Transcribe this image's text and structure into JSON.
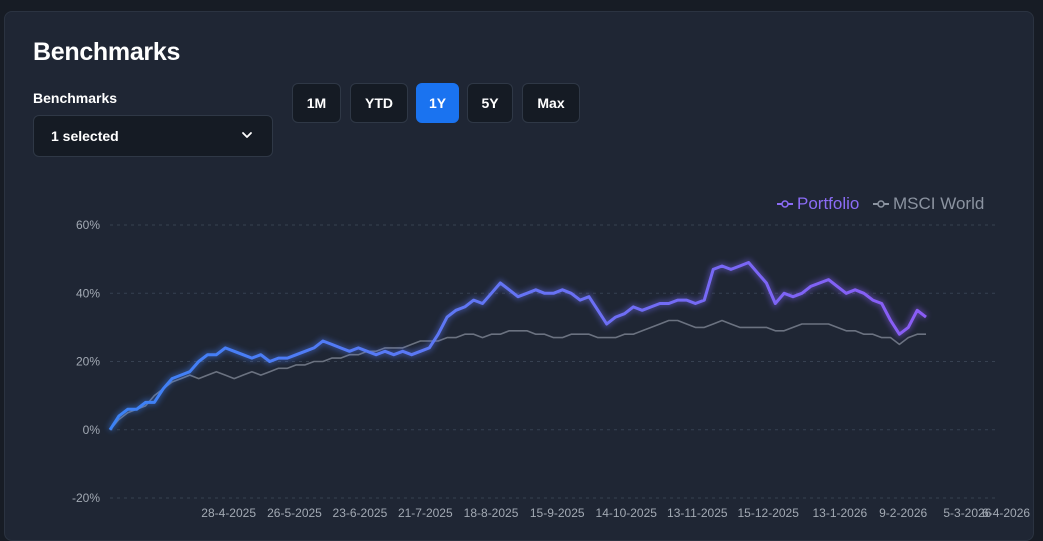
{
  "card": {
    "title": "Benchmarks"
  },
  "benchmarks_select": {
    "label": "Benchmarks",
    "value": "1 selected"
  },
  "range_buttons": [
    {
      "label": "1M",
      "active": false
    },
    {
      "label": "YTD",
      "active": false
    },
    {
      "label": "1Y",
      "active": true
    },
    {
      "label": "5Y",
      "active": false
    },
    {
      "label": "Max",
      "active": false
    }
  ],
  "colors": {
    "portfolio": "#8b6cf6",
    "portfolio_start": "#3b82f6",
    "msci": "#6b7280",
    "accent": "#1a73f0"
  },
  "chart_data": {
    "type": "line",
    "legend_position": "top-right",
    "ylim": [
      -20,
      60
    ],
    "y_ticks": [
      "60%",
      "40%",
      "20%",
      "0%",
      "-20%"
    ],
    "y_tick_values": [
      60,
      40,
      20,
      0,
      -20
    ],
    "grid": true,
    "x_tick_labels": [
      "28-4-2025",
      "26-5-2025",
      "23-6-2025",
      "21-7-2025",
      "18-8-2025",
      "15-9-2025",
      "14-10-2025",
      "13-11-2025",
      "15-12-2025",
      "13-1-2026",
      "9-2-2026",
      "5-3-2026",
      "6-4-2026"
    ],
    "x_tick_positions": [
      0.0789,
      0.1568,
      0.2342,
      0.3116,
      0.3894,
      0.4677,
      0.5494,
      0.6335,
      0.7174,
      0.8022,
      0.8771,
      0.9531,
      0.9989
    ],
    "series": [
      {
        "name": "Portfolio",
        "points": [
          [
            0,
            0
          ],
          [
            0.01,
            4
          ],
          [
            0.02,
            6
          ],
          [
            0.03,
            6
          ],
          [
            0.04,
            8
          ],
          [
            0.05,
            8
          ],
          [
            0.06,
            12
          ],
          [
            0.07,
            15
          ],
          [
            0.08,
            16
          ],
          [
            0.09,
            17
          ],
          [
            0.1,
            20
          ],
          [
            0.11,
            22
          ],
          [
            0.12,
            22
          ],
          [
            0.13,
            24
          ],
          [
            0.14,
            23
          ],
          [
            0.15,
            22
          ],
          [
            0.16,
            21
          ],
          [
            0.17,
            22
          ],
          [
            0.18,
            20
          ],
          [
            0.19,
            21
          ],
          [
            0.2,
            21
          ],
          [
            0.21,
            22
          ],
          [
            0.22,
            23
          ],
          [
            0.23,
            24
          ],
          [
            0.24,
            26
          ],
          [
            0.25,
            25
          ],
          [
            0.26,
            24
          ],
          [
            0.27,
            23
          ],
          [
            0.28,
            24
          ],
          [
            0.29,
            23
          ],
          [
            0.3,
            22
          ],
          [
            0.31,
            23
          ],
          [
            0.32,
            22
          ],
          [
            0.33,
            23
          ],
          [
            0.34,
            22
          ],
          [
            0.35,
            23
          ],
          [
            0.36,
            24
          ],
          [
            0.37,
            28
          ],
          [
            0.38,
            33
          ],
          [
            0.39,
            35
          ],
          [
            0.4,
            36
          ],
          [
            0.41,
            38
          ],
          [
            0.42,
            37
          ],
          [
            0.43,
            40
          ],
          [
            0.44,
            43
          ],
          [
            0.45,
            41
          ],
          [
            0.46,
            39
          ],
          [
            0.47,
            40
          ],
          [
            0.48,
            41
          ],
          [
            0.49,
            40
          ],
          [
            0.5,
            40
          ],
          [
            0.51,
            41
          ],
          [
            0.52,
            40
          ],
          [
            0.53,
            38
          ],
          [
            0.54,
            39
          ],
          [
            0.55,
            35
          ],
          [
            0.56,
            31
          ],
          [
            0.57,
            33
          ],
          [
            0.58,
            34
          ],
          [
            0.59,
            36
          ],
          [
            0.6,
            35
          ],
          [
            0.61,
            36
          ],
          [
            0.62,
            37
          ],
          [
            0.63,
            37
          ],
          [
            0.64,
            38
          ],
          [
            0.65,
            38
          ],
          [
            0.66,
            37
          ],
          [
            0.67,
            38
          ],
          [
            0.68,
            47
          ],
          [
            0.69,
            48
          ],
          [
            0.7,
            47
          ],
          [
            0.71,
            48
          ],
          [
            0.72,
            49
          ],
          [
            0.73,
            46
          ],
          [
            0.74,
            43
          ],
          [
            0.75,
            37
          ],
          [
            0.76,
            40
          ],
          [
            0.77,
            39
          ],
          [
            0.78,
            40
          ],
          [
            0.79,
            42
          ],
          [
            0.8,
            43
          ],
          [
            0.81,
            44
          ],
          [
            0.82,
            42
          ],
          [
            0.83,
            40
          ],
          [
            0.84,
            41
          ],
          [
            0.85,
            40
          ],
          [
            0.86,
            38
          ],
          [
            0.87,
            37
          ],
          [
            0.88,
            32
          ],
          [
            0.89,
            28
          ],
          [
            0.9,
            30
          ],
          [
            0.91,
            35
          ],
          [
            0.92,
            33
          ]
        ]
      },
      {
        "name": "MSCI World",
        "points": [
          [
            0,
            0
          ],
          [
            0.01,
            3
          ],
          [
            0.02,
            5
          ],
          [
            0.03,
            6
          ],
          [
            0.04,
            7
          ],
          [
            0.05,
            10
          ],
          [
            0.06,
            12
          ],
          [
            0.07,
            14
          ],
          [
            0.08,
            15
          ],
          [
            0.09,
            16
          ],
          [
            0.1,
            15
          ],
          [
            0.11,
            16
          ],
          [
            0.12,
            17
          ],
          [
            0.13,
            16
          ],
          [
            0.14,
            15
          ],
          [
            0.15,
            16
          ],
          [
            0.16,
            17
          ],
          [
            0.17,
            16
          ],
          [
            0.18,
            17
          ],
          [
            0.19,
            18
          ],
          [
            0.2,
            18
          ],
          [
            0.21,
            19
          ],
          [
            0.22,
            19
          ],
          [
            0.23,
            20
          ],
          [
            0.24,
            20
          ],
          [
            0.25,
            21
          ],
          [
            0.26,
            21
          ],
          [
            0.27,
            22
          ],
          [
            0.28,
            22
          ],
          [
            0.29,
            23
          ],
          [
            0.3,
            23
          ],
          [
            0.31,
            24
          ],
          [
            0.32,
            24
          ],
          [
            0.33,
            24
          ],
          [
            0.34,
            25
          ],
          [
            0.35,
            26
          ],
          [
            0.36,
            26
          ],
          [
            0.37,
            26
          ],
          [
            0.38,
            27
          ],
          [
            0.39,
            27
          ],
          [
            0.4,
            28
          ],
          [
            0.41,
            28
          ],
          [
            0.42,
            27
          ],
          [
            0.43,
            28
          ],
          [
            0.44,
            28
          ],
          [
            0.45,
            29
          ],
          [
            0.46,
            29
          ],
          [
            0.47,
            29
          ],
          [
            0.48,
            28
          ],
          [
            0.49,
            28
          ],
          [
            0.5,
            27
          ],
          [
            0.51,
            27
          ],
          [
            0.52,
            28
          ],
          [
            0.53,
            28
          ],
          [
            0.54,
            28
          ],
          [
            0.55,
            27
          ],
          [
            0.56,
            27
          ],
          [
            0.57,
            27
          ],
          [
            0.58,
            28
          ],
          [
            0.59,
            28
          ],
          [
            0.6,
            29
          ],
          [
            0.61,
            30
          ],
          [
            0.62,
            31
          ],
          [
            0.63,
            32
          ],
          [
            0.64,
            32
          ],
          [
            0.65,
            31
          ],
          [
            0.66,
            30
          ],
          [
            0.67,
            30
          ],
          [
            0.68,
            31
          ],
          [
            0.69,
            32
          ],
          [
            0.7,
            31
          ],
          [
            0.71,
            30
          ],
          [
            0.72,
            30
          ],
          [
            0.73,
            30
          ],
          [
            0.74,
            30
          ],
          [
            0.75,
            29
          ],
          [
            0.76,
            29
          ],
          [
            0.77,
            30
          ],
          [
            0.78,
            31
          ],
          [
            0.79,
            31
          ],
          [
            0.8,
            31
          ],
          [
            0.81,
            31
          ],
          [
            0.82,
            30
          ],
          [
            0.83,
            29
          ],
          [
            0.84,
            29
          ],
          [
            0.85,
            28
          ],
          [
            0.86,
            28
          ],
          [
            0.87,
            27
          ],
          [
            0.88,
            27
          ],
          [
            0.89,
            25
          ],
          [
            0.9,
            27
          ],
          [
            0.91,
            28
          ],
          [
            0.92,
            28
          ]
        ]
      }
    ]
  }
}
